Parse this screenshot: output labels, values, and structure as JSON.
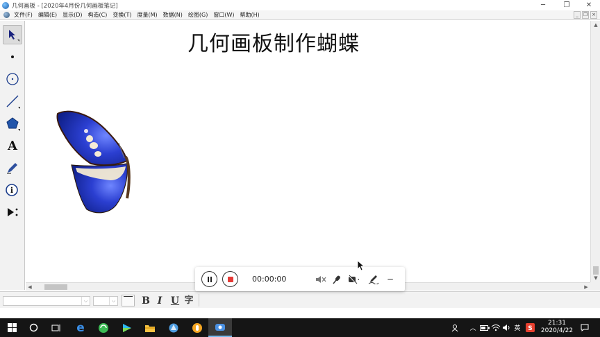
{
  "window": {
    "title": "几何画板 - [2020年4月份几何画板笔记]",
    "controls": {
      "minimize": "─",
      "maximize": "❐",
      "close": "✕"
    }
  },
  "menubar": {
    "items": [
      "文件(F)",
      "编辑(E)",
      "显示(D)",
      "构造(C)",
      "变换(T)",
      "度量(M)",
      "数据(N)",
      "绘图(G)",
      "窗口(W)",
      "帮助(H)"
    ],
    "mdi_controls": [
      "_",
      "❐",
      "×"
    ]
  },
  "toolbox": {
    "tools": [
      {
        "name": "arrow-select-tool",
        "icon": "arrow-pointer-icon",
        "active": true
      },
      {
        "name": "point-tool",
        "icon": "point-icon"
      },
      {
        "name": "compass-tool",
        "icon": "circle-icon"
      },
      {
        "name": "straightedge-tool",
        "icon": "line-icon"
      },
      {
        "name": "polygon-tool",
        "icon": "pentagon-icon"
      },
      {
        "name": "text-tool",
        "icon": "text-a-icon",
        "glyph": "A"
      },
      {
        "name": "marker-tool",
        "icon": "pencil-icon"
      },
      {
        "name": "information-tool",
        "icon": "info-icon"
      },
      {
        "name": "custom-tool",
        "icon": "play-more-icon"
      }
    ]
  },
  "canvas": {
    "title": "几何画板制作蝴蝶",
    "butterfly_color": "#2b3fd1"
  },
  "formatbar": {
    "bold": "B",
    "italic": "I",
    "underline": "U",
    "vertical_text": "字"
  },
  "recorder": {
    "timer": "00:00:00",
    "stop_color": "#e53935",
    "minimize": "─"
  },
  "taskbar": {
    "tray_ime": "英",
    "time": "21:31",
    "date": "2020/4/22"
  }
}
